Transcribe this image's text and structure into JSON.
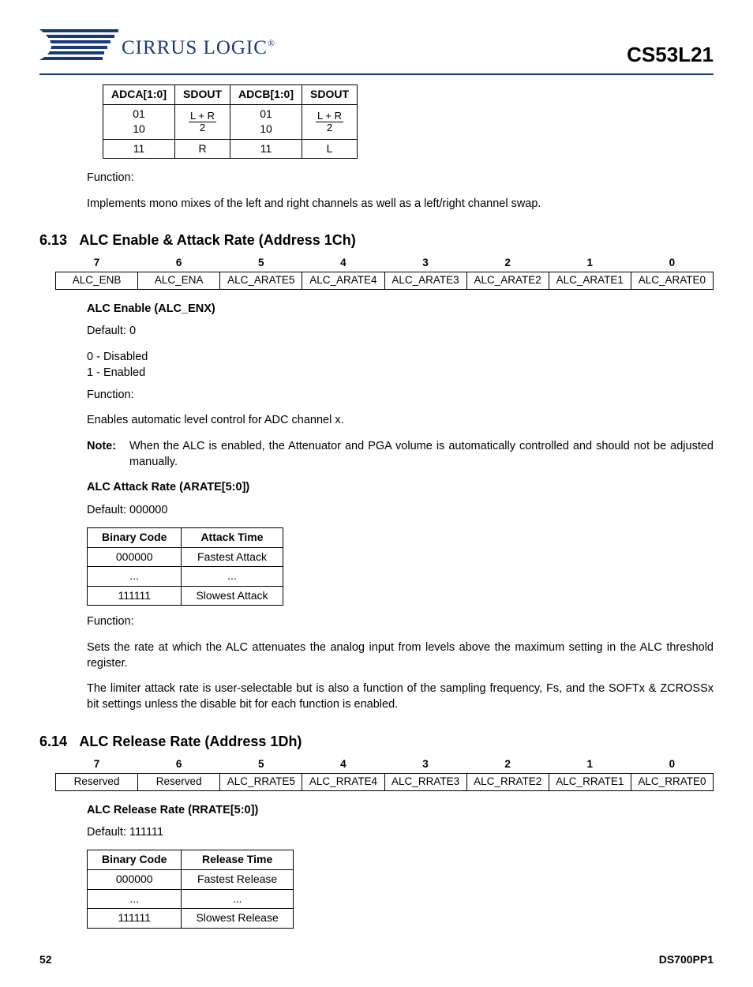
{
  "header": {
    "logo_text": "CIRRUS LOGIC",
    "part_number": "CS53L21"
  },
  "adc_table": {
    "headers": [
      "ADCA[1:0]",
      "SDOUT",
      "ADCB[1:0]",
      "SDOUT"
    ],
    "rows": [
      {
        "c0": "01",
        "c1_top": "L + R",
        "c1_bot": "2",
        "c2": "01",
        "c3_top": "L + R",
        "c3_bot": "2",
        "frac": true
      },
      {
        "c0": "10",
        "c2": "10",
        "merge": true
      },
      {
        "c0": "11",
        "c1": "R",
        "c2": "11",
        "c3": "L"
      }
    ]
  },
  "function_label": "Function:",
  "adc_function_text": "Implements mono mixes of the left and right channels as well as a left/right channel swap.",
  "section_613": {
    "num": "6.13",
    "title": "ALC Enable & Attack Rate (Address 1Ch)",
    "bits_header": [
      "7",
      "6",
      "5",
      "4",
      "3",
      "2",
      "1",
      "0"
    ],
    "bits_row": [
      "ALC_ENB",
      "ALC_ENA",
      "ALC_ARATE5",
      "ALC_ARATE4",
      "ALC_ARATE3",
      "ALC_ARATE2",
      "ALC_ARATE1",
      "ALC_ARATE0"
    ],
    "sub1_title": "ALC Enable (ALC_ENX)",
    "sub1_default": "Default: 0",
    "sub1_opt0": "0 - Disabled",
    "sub1_opt1": "1 - Enabled",
    "sub1_function": "Enables automatic level control for ADC channel x.",
    "note_label": "Note:",
    "note_text": "When the ALC is enabled, the Attenuator and PGA volume is automatically controlled and should not be adjusted manually.",
    "sub2_title": "ALC Attack Rate (ARATE[5:0])",
    "sub2_default": "Default: 000000",
    "attack_table": {
      "headers": [
        "Binary Code",
        "Attack Time"
      ],
      "rows": [
        [
          "000000",
          "Fastest Attack"
        ],
        [
          "...",
          "..."
        ],
        [
          "111111",
          "Slowest Attack"
        ]
      ]
    },
    "sub2_func1": "Sets the rate at which the ALC attenuates the analog input from levels above the maximum setting in the ALC threshold register.",
    "sub2_func2": "The limiter attack rate is user-selectable but is also a function of the sampling frequency, Fs, and the SOFTx & ZCROSSx bit settings unless the disable bit for each function is enabled."
  },
  "section_614": {
    "num": "6.14",
    "title": "ALC Release Rate (Address 1Dh)",
    "bits_header": [
      "7",
      "6",
      "5",
      "4",
      "3",
      "2",
      "1",
      "0"
    ],
    "bits_row": [
      "Reserved",
      "Reserved",
      "ALC_RRATE5",
      "ALC_RRATE4",
      "ALC_RRATE3",
      "ALC_RRATE2",
      "ALC_RRATE1",
      "ALC_RRATE0"
    ],
    "sub_title": "ALC Release Rate (RRATE[5:0])",
    "sub_default": "Default: 111111",
    "release_table": {
      "headers": [
        "Binary Code",
        "Release Time"
      ],
      "rows": [
        [
          "000000",
          "Fastest Release"
        ],
        [
          "...",
          "..."
        ],
        [
          "111111",
          "Slowest Release"
        ]
      ]
    }
  },
  "footer": {
    "page": "52",
    "doc": "DS700PP1"
  }
}
